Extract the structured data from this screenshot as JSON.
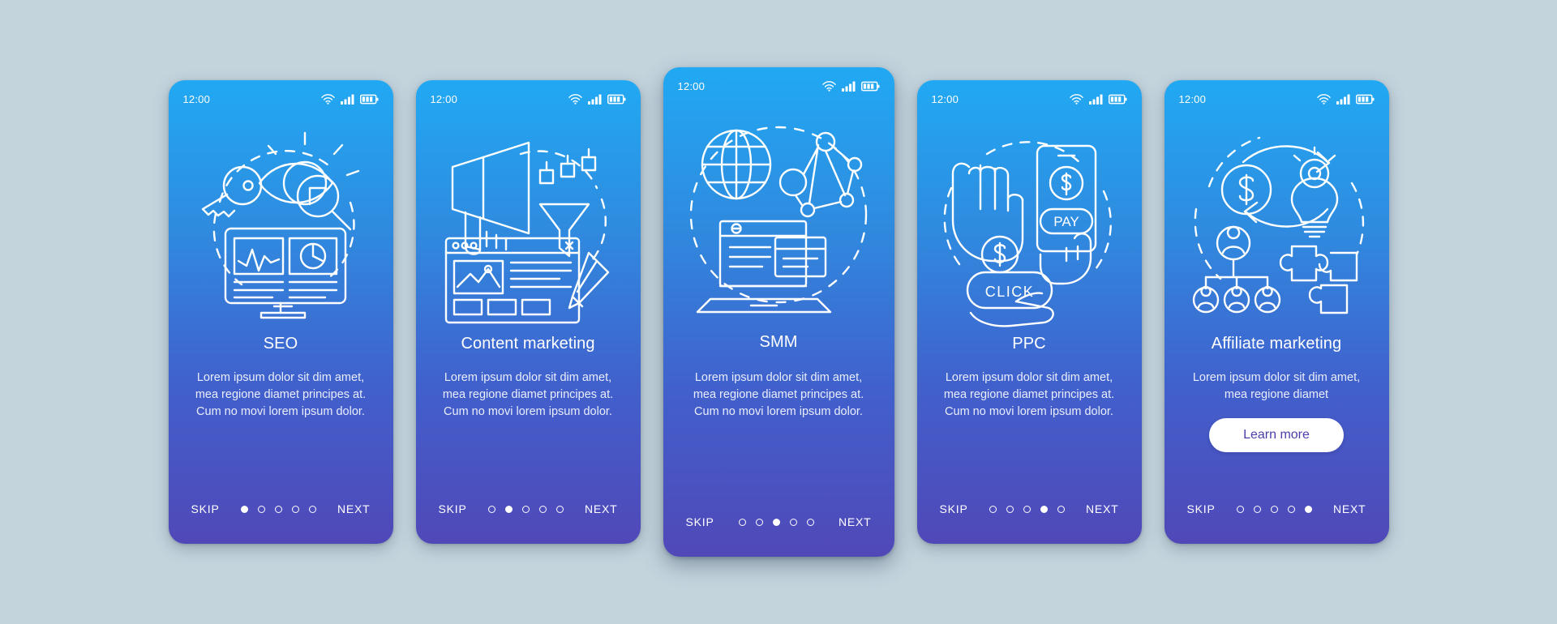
{
  "background_color": "#c4d4dd",
  "theme": {
    "gradient_start": "#21a9f3",
    "gradient_end": "#5148b8",
    "accent_button_bg": "#ffffff",
    "accent_button_text": "#4a3fa8",
    "line_art_color": "#ffffff"
  },
  "status_bar": {
    "time": "12:00",
    "icons": [
      "wifi-icon",
      "signal-icon",
      "battery-icon"
    ]
  },
  "nav": {
    "skip_label": "SKIP",
    "next_label": "NEXT",
    "total_dots": 5
  },
  "screens": [
    {
      "id": "seo",
      "title": "SEO",
      "description": "Lorem ipsum dolor sit dim amet, mea regione diamet principes at. Cum no movi lorem ipsum dolor.",
      "illustration": "seo-illustration",
      "active_dot": 1,
      "has_cta": false,
      "cta_label": ""
    },
    {
      "id": "content-marketing",
      "title": "Content marketing",
      "description": "Lorem ipsum dolor sit dim amet, mea regione diamet principes at. Cum no movi lorem ipsum dolor.",
      "illustration": "content-marketing-illustration",
      "active_dot": 2,
      "has_cta": false,
      "cta_label": ""
    },
    {
      "id": "smm",
      "title": "SMM",
      "description": "Lorem ipsum dolor sit dim amet, mea regione diamet principes at. Cum no movi lorem ipsum dolor.",
      "illustration": "smm-illustration",
      "active_dot": 3,
      "has_cta": false,
      "cta_label": ""
    },
    {
      "id": "ppc",
      "title": "PPC",
      "description": "Lorem ipsum dolor sit dim amet, mea regione diamet principes at. Cum no movi lorem ipsum dolor.",
      "illustration": "ppc-illustration",
      "active_dot": 4,
      "has_cta": false,
      "cta_label": ""
    },
    {
      "id": "affiliate-marketing",
      "title": "Affiliate marketing",
      "description": "Lorem ipsum dolor sit dim amet, mea regione diamet",
      "illustration": "affiliate-marketing-illustration",
      "active_dot": 5,
      "has_cta": true,
      "cta_label": "Learn more"
    }
  ]
}
